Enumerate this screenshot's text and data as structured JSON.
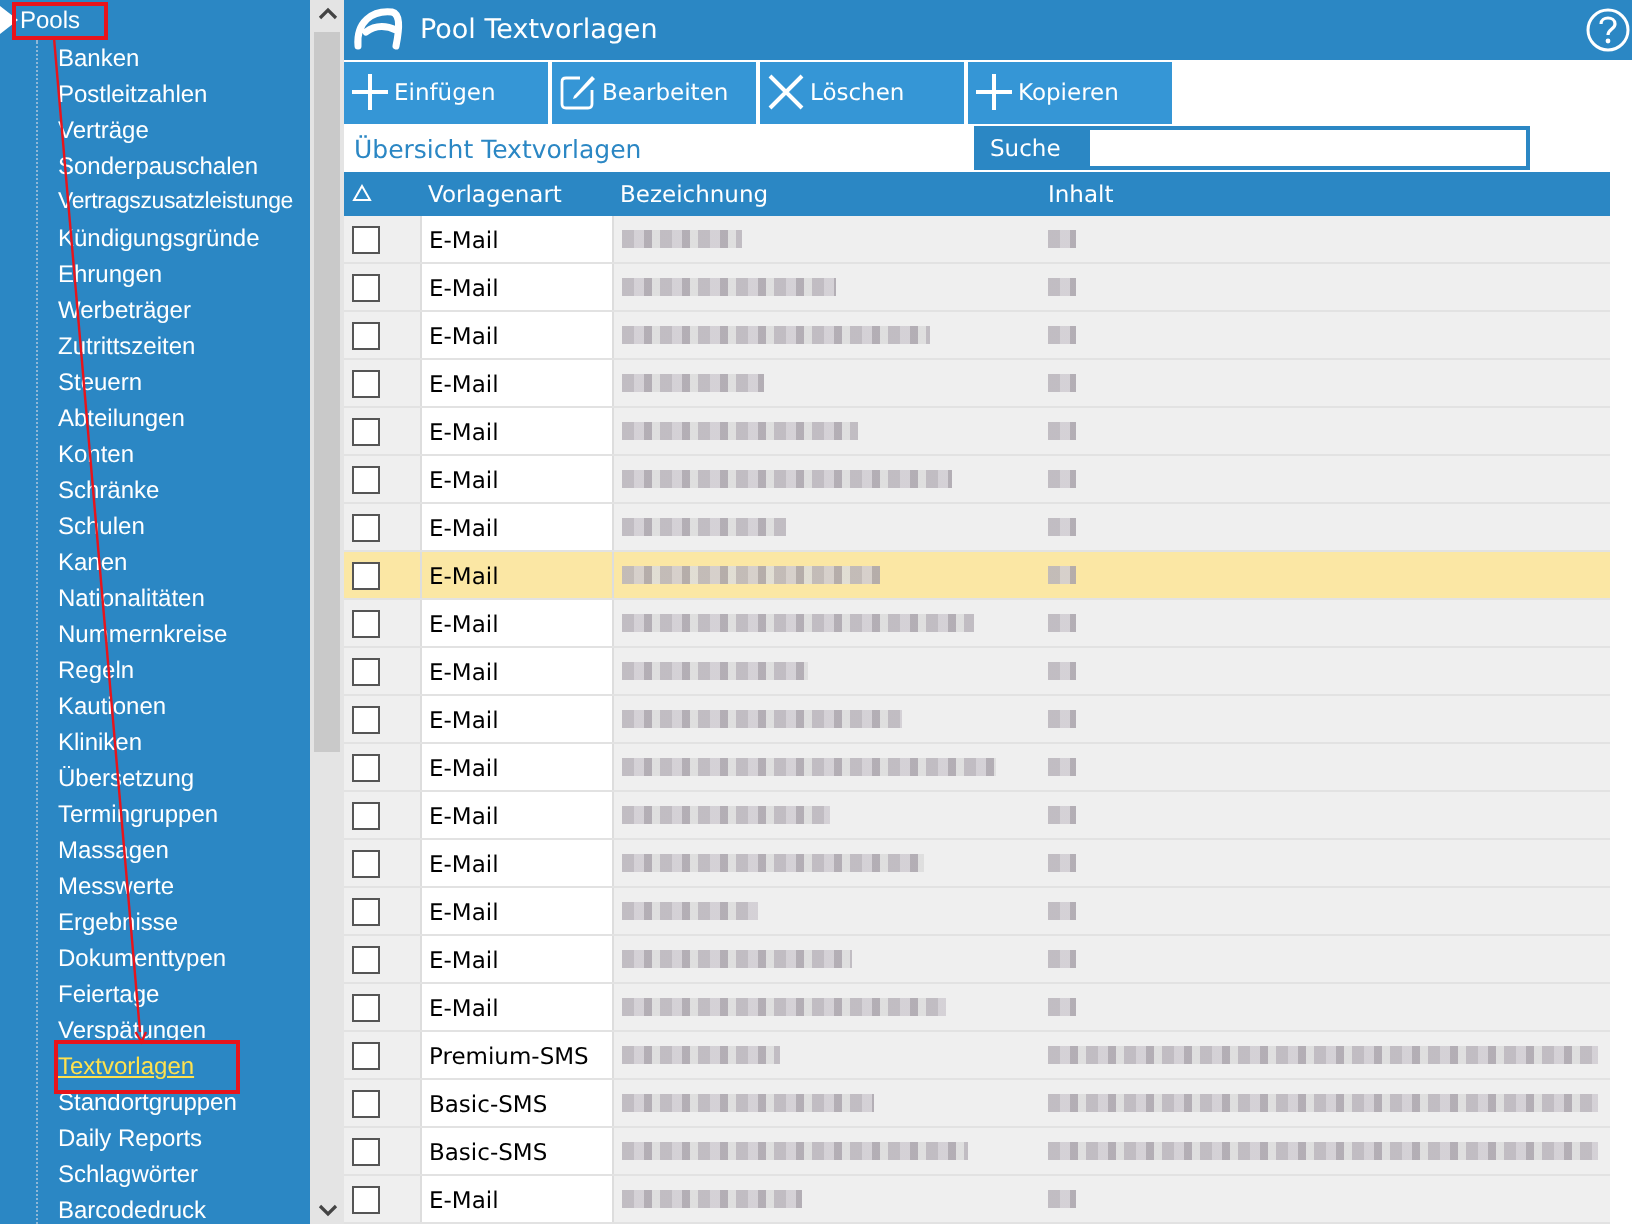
{
  "sidebar": {
    "root": {
      "label": "Pools",
      "expanded": true,
      "children": [
        {
          "label": "Banken",
          "selected": false
        },
        {
          "label": "Postleitzahlen",
          "selected": false
        },
        {
          "label": "Verträge",
          "selected": false
        },
        {
          "label": "Sonderpauschalen",
          "selected": false
        },
        {
          "label": "Vertragszusatzleistunge",
          "selected": false
        },
        {
          "label": "Kündigungsgründe",
          "selected": false
        },
        {
          "label": "Ehrungen",
          "selected": false
        },
        {
          "label": "Werbeträger",
          "selected": false
        },
        {
          "label": "Zutrittszeiten",
          "selected": false
        },
        {
          "label": "Steuern",
          "selected": false
        },
        {
          "label": "Abteilungen",
          "selected": false
        },
        {
          "label": "Konten",
          "selected": false
        },
        {
          "label": "Schränke",
          "selected": false
        },
        {
          "label": "Schulen",
          "selected": false
        },
        {
          "label": "Kanen",
          "selected": false
        },
        {
          "label": "Nationalitäten",
          "selected": false
        },
        {
          "label": "Nummernkreise",
          "selected": false
        },
        {
          "label": "Regeln",
          "selected": false
        },
        {
          "label": "Kautionen",
          "selected": false
        },
        {
          "label": "Kliniken",
          "selected": false
        },
        {
          "label": "Übersetzung",
          "selected": false
        },
        {
          "label": "Termingruppen",
          "selected": false
        },
        {
          "label": "Massagen",
          "selected": false
        },
        {
          "label": "Messwerte",
          "selected": false
        },
        {
          "label": "Ergebnisse",
          "selected": false
        },
        {
          "label": "Dokumenttypen",
          "selected": false
        },
        {
          "label": "Feiertage",
          "selected": false
        },
        {
          "label": "Verspätungen",
          "selected": false
        },
        {
          "label": "Textvorlagen",
          "selected": true
        },
        {
          "label": "Standortgruppen",
          "selected": false
        },
        {
          "label": "Daily Reports",
          "selected": false
        },
        {
          "label": "Schlagwörter",
          "selected": false
        },
        {
          "label": "Barcodedruck",
          "selected": false
        }
      ]
    }
  },
  "window": {
    "title": "Pool Textvorlagen"
  },
  "toolbar": [
    {
      "label": "Einfügen",
      "kind": "plus"
    },
    {
      "label": "Bearbeiten",
      "kind": "edit"
    },
    {
      "label": "Löschen",
      "kind": "cross"
    },
    {
      "label": "Kopieren",
      "kind": "plus"
    }
  ],
  "section_title": "Übersicht Textvorlagen",
  "search": {
    "label": "Suche"
  },
  "table": {
    "columns": [
      "Vorlagenart",
      "Bezeichnung",
      "Inhalt"
    ],
    "rows": [
      {
        "type": "E-Mail",
        "checked": false,
        "selected": false
      },
      {
        "type": "E-Mail",
        "checked": false,
        "selected": false
      },
      {
        "type": "E-Mail",
        "checked": false,
        "selected": false
      },
      {
        "type": "E-Mail",
        "checked": false,
        "selected": false
      },
      {
        "type": "E-Mail",
        "checked": false,
        "selected": false
      },
      {
        "type": "E-Mail",
        "checked": false,
        "selected": false
      },
      {
        "type": "E-Mail",
        "checked": false,
        "selected": false
      },
      {
        "type": "E-Mail",
        "checked": false,
        "selected": true
      },
      {
        "type": "E-Mail",
        "checked": false,
        "selected": false
      },
      {
        "type": "E-Mail",
        "checked": false,
        "selected": false
      },
      {
        "type": "E-Mail",
        "checked": false,
        "selected": false
      },
      {
        "type": "E-Mail",
        "checked": false,
        "selected": false
      },
      {
        "type": "E-Mail",
        "checked": false,
        "selected": false
      },
      {
        "type": "E-Mail",
        "checked": false,
        "selected": false
      },
      {
        "type": "E-Mail",
        "checked": false,
        "selected": false
      },
      {
        "type": "E-Mail",
        "checked": false,
        "selected": false
      },
      {
        "type": "E-Mail",
        "checked": false,
        "selected": false
      },
      {
        "type": "Premium-SMS",
        "checked": false,
        "selected": false
      },
      {
        "type": "Basic-SMS",
        "checked": false,
        "selected": false
      },
      {
        "type": "Basic-SMS",
        "checked": false,
        "selected": false
      },
      {
        "type": "E-Mail",
        "checked": false,
        "selected": false
      }
    ]
  }
}
